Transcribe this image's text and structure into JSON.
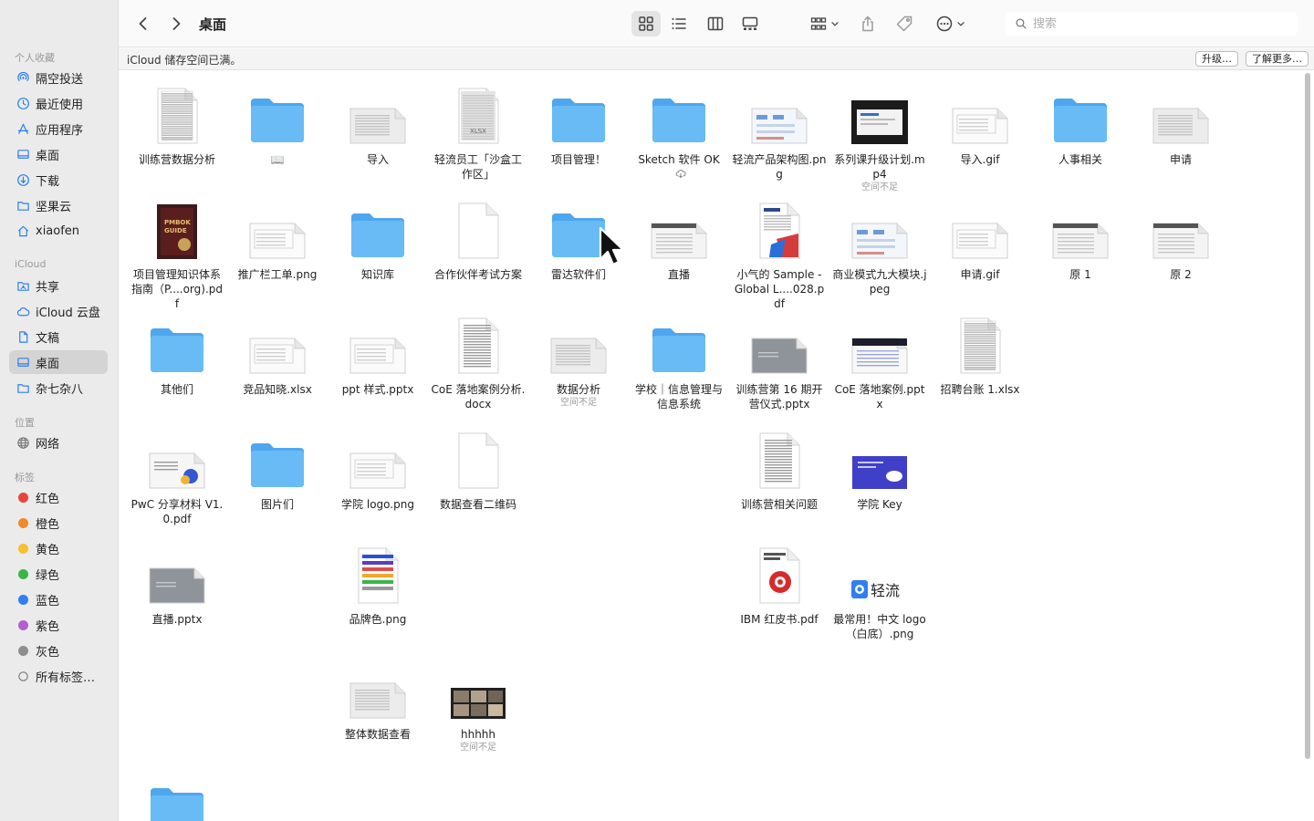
{
  "toolbar": {
    "title": "桌面",
    "search_placeholder": "搜索"
  },
  "banner": {
    "message": "iCloud 储存空间已满。",
    "upgrade_label": "升级…",
    "learn_more_label": "了解更多…"
  },
  "sidebar": {
    "sections": {
      "favorites": "个人收藏",
      "icloud": "iCloud",
      "locations": "位置",
      "tags": "标签"
    },
    "favorites": [
      {
        "label": "隔空投送",
        "icon": "airdrop-icon"
      },
      {
        "label": "最近使用",
        "icon": "clock-icon"
      },
      {
        "label": "应用程序",
        "icon": "apps-icon"
      },
      {
        "label": "桌面",
        "icon": "desktop-icon"
      },
      {
        "label": "下载",
        "icon": "download-icon"
      },
      {
        "label": "坚果云",
        "icon": "folder-icon"
      },
      {
        "label": "xiaofen",
        "icon": "home-icon"
      }
    ],
    "icloud_items": [
      {
        "label": "共享",
        "icon": "shared-folder-icon"
      },
      {
        "label": "iCloud 云盘",
        "icon": "cloud-icon"
      },
      {
        "label": "文稿",
        "icon": "document-icon"
      },
      {
        "label": "桌面",
        "icon": "desktop-icon",
        "selected": true
      },
      {
        "label": "杂七杂八",
        "icon": "folder-icon"
      }
    ],
    "locations": [
      {
        "label": "网络",
        "icon": "globe-icon"
      }
    ],
    "tags": [
      {
        "label": "红色",
        "color": "#e8453c"
      },
      {
        "label": "橙色",
        "color": "#f08a2c"
      },
      {
        "label": "黄色",
        "color": "#f5c12e"
      },
      {
        "label": "绿色",
        "color": "#3ab54a"
      },
      {
        "label": "蓝色",
        "color": "#2f7ff0"
      },
      {
        "label": "紫色",
        "color": "#b15fd1"
      },
      {
        "label": "灰色",
        "color": "#8e8e8e"
      }
    ],
    "all_tags_label": "所有标签…"
  },
  "files": [
    {
      "name": "训练营数据分析",
      "kind": "sheet"
    },
    {
      "name": "📖",
      "kind": "folder"
    },
    {
      "name": "导入",
      "kind": "slide-gray"
    },
    {
      "name": "轻流员工「沙盒工作区」",
      "kind": "xlsx",
      "badge": "XLSX"
    },
    {
      "name": "项目管理！",
      "kind": "folder"
    },
    {
      "name": "Sketch 软件 OK",
      "kind": "folder",
      "cloud": true
    },
    {
      "name": "轻流产品架构图.png",
      "kind": "diagram"
    },
    {
      "name": "系列课升级计划.mp4",
      "kind": "video",
      "note": "空间不足"
    },
    {
      "name": "导入.gif",
      "kind": "slide-white"
    },
    {
      "name": "人事相关",
      "kind": "folder"
    },
    {
      "name": "申请",
      "kind": "slide-gray"
    },
    {
      "name": "项目管理知识体系指南（P....org).pdf",
      "kind": "book"
    },
    {
      "name": "推广栏工单.png",
      "kind": "slide-white"
    },
    {
      "name": "知识库",
      "kind": "folder"
    },
    {
      "name": "合作伙伴考试方案",
      "kind": "doc-blank"
    },
    {
      "name": "雷达软件们",
      "kind": "folder"
    },
    {
      "name": "直播",
      "kind": "slide-dark"
    },
    {
      "name": "小气的 Sample - Global L....028.pdf",
      "kind": "pdf-red"
    },
    {
      "name": "商业模式九大模块.jpeg",
      "kind": "diagram"
    },
    {
      "name": "申请.gif",
      "kind": "slide-white"
    },
    {
      "name": "原 1",
      "kind": "slide-dark"
    },
    {
      "name": "原 2",
      "kind": "slide-dark"
    },
    {
      "name": "其他们",
      "kind": "folder"
    },
    {
      "name": "竞品知晓.xlsx",
      "kind": "slide-white"
    },
    {
      "name": "ppt 样式.pptx",
      "kind": "slide-white"
    },
    {
      "name": "CoE 落地案例分析.docx",
      "kind": "doc-text"
    },
    {
      "name": "数据分析",
      "kind": "slide-gray",
      "note": "空间不足"
    },
    {
      "name": "学校｜信息管理与信息系统",
      "kind": "folder"
    },
    {
      "name": "训练营第 16 期开营仪式.pptx",
      "kind": "slide-solid-gray"
    },
    {
      "name": "CoE 落地案例.pptx",
      "kind": "slide-dark-band"
    },
    {
      "name": "招聘台账 1.xlsx",
      "kind": "sheet"
    },
    {
      "name": "PwC 分享材料 V1.0.pdf",
      "kind": "slide-blue-accent"
    },
    {
      "name": "图片们",
      "kind": "folder"
    },
    {
      "name": "学院 logo.png",
      "kind": "slide-white"
    },
    {
      "name": "数据查看二维码",
      "kind": "doc-blank"
    },
    {
      "name": "训练营相关问题",
      "kind": "doc-text"
    },
    {
      "name": "学院 Key",
      "kind": "slide-purple"
    },
    {
      "name": "直播.pptx",
      "kind": "slide-solid-gray"
    },
    {
      "name": "品牌色.png",
      "kind": "color-bars"
    },
    {
      "name": "IBM 红皮书.pdf",
      "kind": "pdf-ibm"
    },
    {
      "name": "最常用！中文 logo（白底）.png",
      "kind": "logo",
      "logo_text": "轻流"
    },
    {
      "name": "整体数据查看",
      "kind": "slide-gray"
    },
    {
      "name": "hhhhh",
      "kind": "video-thumbs",
      "note": "空间不足"
    },
    {
      "name": "",
      "kind": "folder"
    }
  ]
}
